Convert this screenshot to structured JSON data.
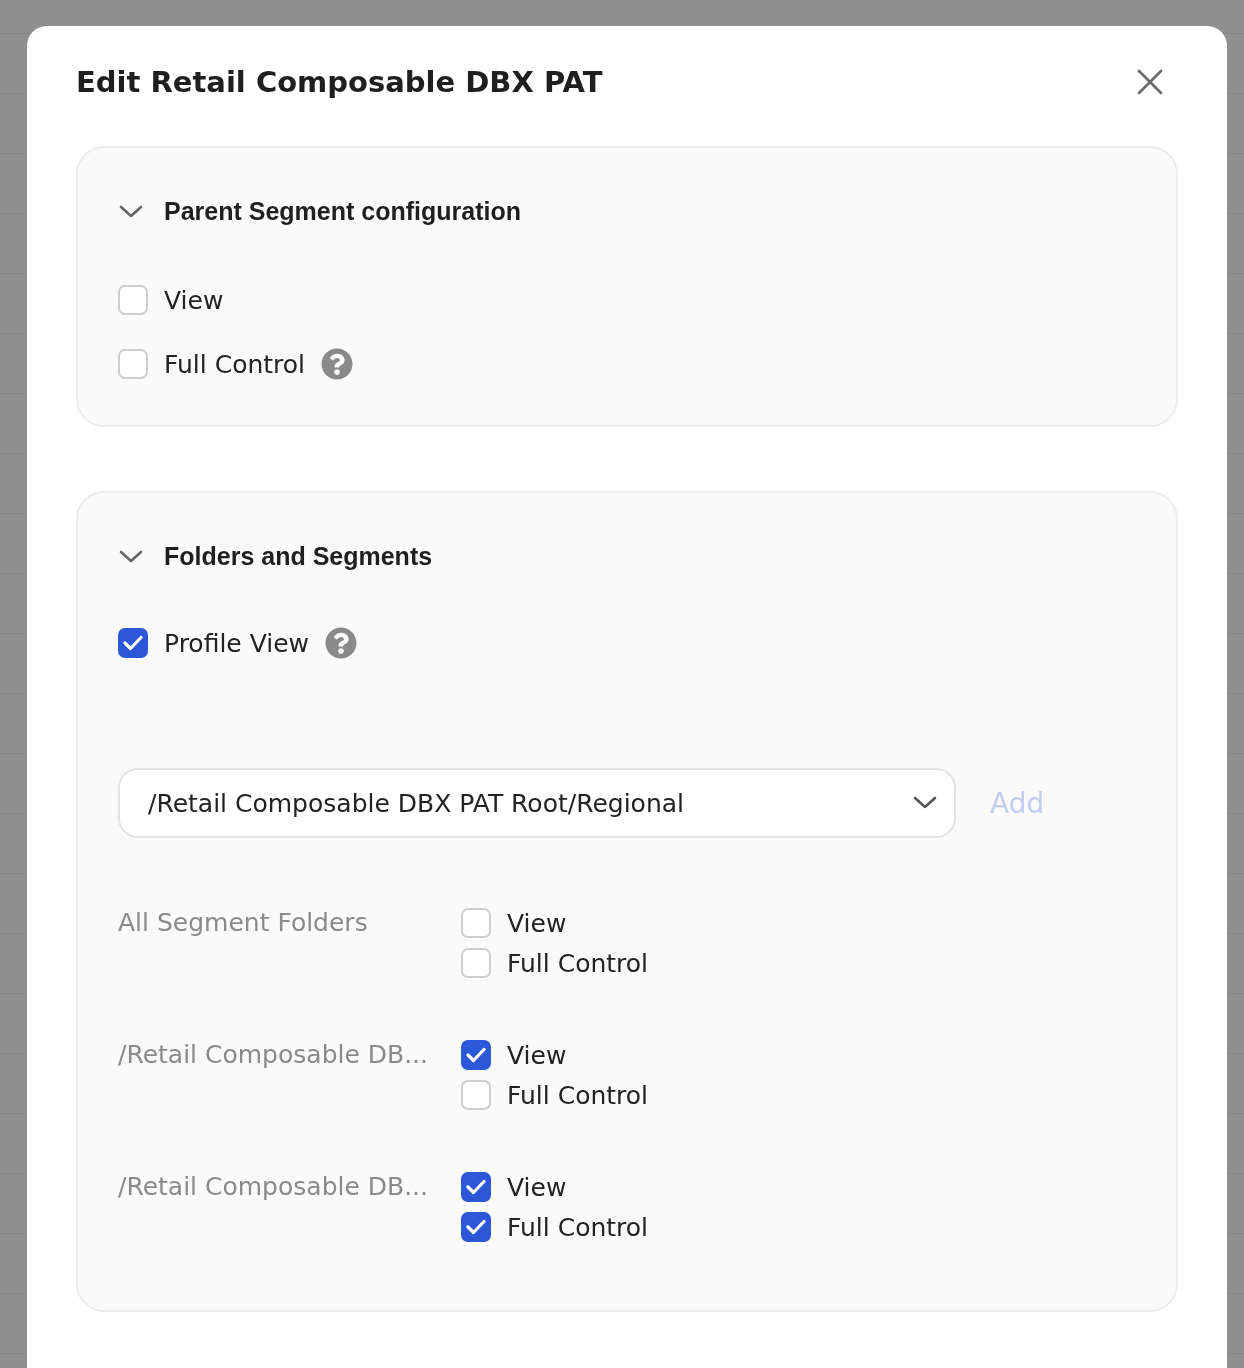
{
  "dialog": {
    "title": "Edit Retail Composable DBX PAT"
  },
  "sections": [
    {
      "title": "Parent Segment configuration",
      "expanded": true,
      "options": [
        {
          "label": "View",
          "checked": false,
          "help": false
        },
        {
          "label": "Full Control",
          "checked": false,
          "help": true
        }
      ]
    },
    {
      "title": "Folders and Segments",
      "expanded": true,
      "options": [
        {
          "label": "Profile View",
          "checked": true,
          "help": true
        }
      ],
      "folder_select": {
        "value": "/Retail Composable DBX PAT Root/Regional",
        "add_label": "Add",
        "add_disabled": true
      },
      "folders": [
        {
          "name": "All Segment Folders",
          "permissions": [
            {
              "label": "View",
              "checked": false
            },
            {
              "label": "Full Control",
              "checked": false
            }
          ]
        },
        {
          "name": "/Retail Composable DB...",
          "permissions": [
            {
              "label": "View",
              "checked": true
            },
            {
              "label": "Full Control",
              "checked": false
            }
          ]
        },
        {
          "name": "/Retail Composable DB...",
          "permissions": [
            {
              "label": "View",
              "checked": true
            },
            {
              "label": "Full Control",
              "checked": true
            }
          ]
        }
      ]
    }
  ]
}
